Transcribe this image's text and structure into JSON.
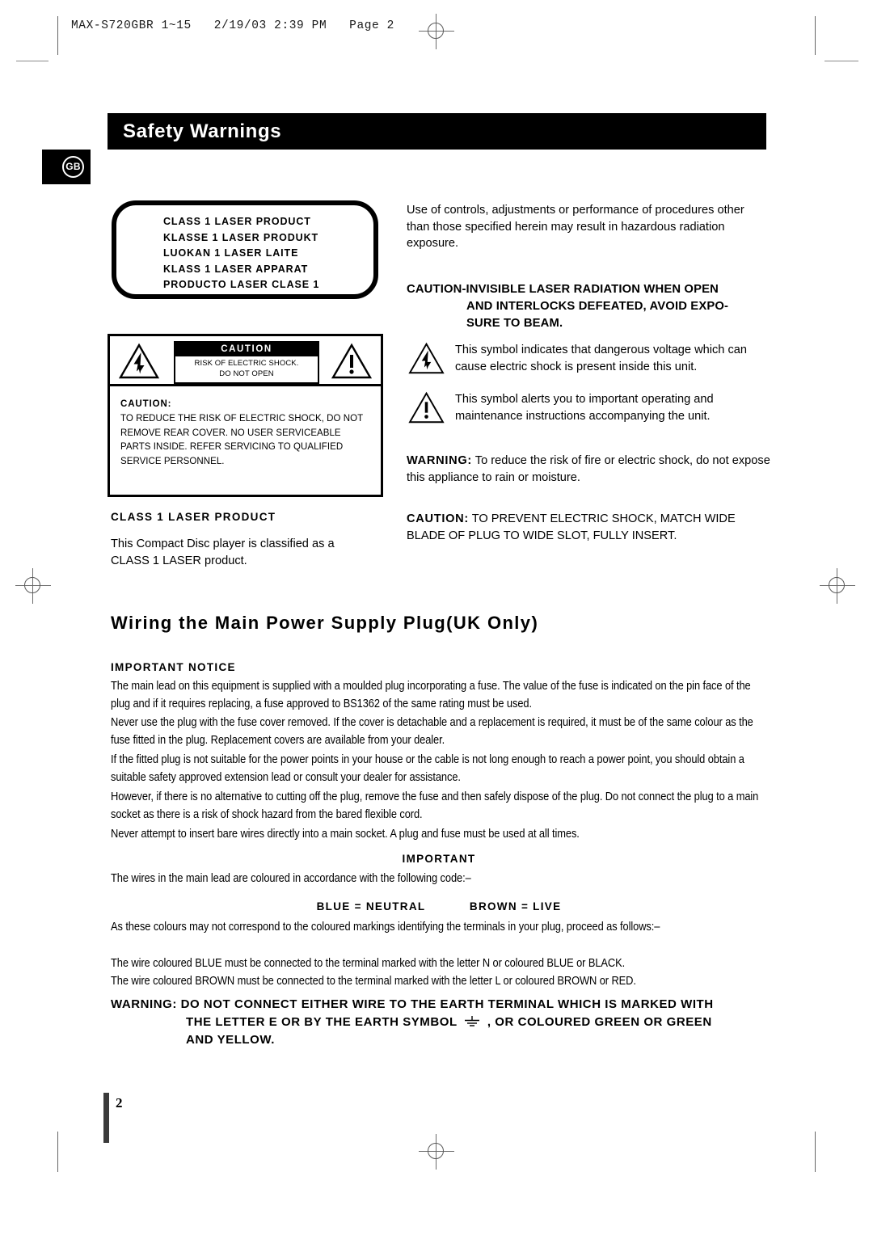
{
  "running_head": "MAX-S720GBR 1~15   2/19/03 2:39 PM   Page 2",
  "header": {
    "title": "Safety Warnings",
    "region_badge": "GB"
  },
  "laser_label_box": {
    "lines": [
      "CLASS 1 LASER PRODUCT",
      "KLASSE 1 LASER PRODUKT",
      "LUOKAN 1 LASER LAITE",
      "KLASS 1 LASER APPARAT",
      "PRODUCTO LASER CLASE 1"
    ]
  },
  "caution_label_box": {
    "banner_title": "CAUTION",
    "banner_line1": "RISK OF ELECTRIC SHOCK.",
    "banner_line2": "DO NOT OPEN",
    "body_label": "CAUTION:",
    "body_text": "TO REDUCE THE RISK OF ELECTRIC SHOCK, DO NOT REMOVE REAR COVER. NO USER SERVICEABLE PARTS INSIDE. REFER SERVICING TO QUALIFIED SERVICE PERSONNEL."
  },
  "right_column": {
    "intro": "Use of controls, adjustments or performance of procedures other than those specified herein may result in hazardous radiation exposure.",
    "laser_caution_line1": "CAUTION-INVISIBLE LASER RADIATION WHEN OPEN",
    "laser_caution_line2": "AND INTERLOCKS DEFEATED, AVOID EXPO-",
    "laser_caution_line3": "SURE TO BEAM.",
    "symbol_voltage_text": "This symbol indicates that dangerous voltage which can cause electric shock is present inside this unit.",
    "symbol_alert_text": "This symbol alerts you to important operating and maintenance instructions accompanying the unit.",
    "warning_lead": "WARNING:",
    "warning_text": "To reduce the risk of fire or electric shock, do not expose this appliance to rain or moisture."
  },
  "class1_section": {
    "heading": "CLASS 1 LASER PRODUCT",
    "text": "This Compact Disc player is classified as a CLASS 1 LASER product."
  },
  "plug_caution": {
    "lead": "CAUTION:",
    "text": "TO PREVENT ELECTRIC SHOCK, MATCH WIDE BLADE OF PLUG TO WIDE SLOT, FULLY INSERT."
  },
  "wiring": {
    "title": "Wiring the Main Power Supply Plug(UK Only)",
    "important_notice_heading": "IMPORTANT NOTICE",
    "paragraphs": [
      "The main lead on this equipment is supplied with a moulded plug incorporating a fuse. The value of the fuse is indicated on the pin face of the plug and if it requires replacing, a fuse approved to BS1362 of the same rating must be used.",
      "Never use the plug with the fuse cover removed. If the cover is detachable and a replacement is required, it must be of the same colour as the fuse fitted in the plug. Replacement covers are available from your dealer.",
      "If the fitted plug is not suitable for the power points in your house or the cable is not long enough to reach a power point, you should obtain a suitable safety approved extension lead or consult your dealer for assistance.",
      "However, if there is no alternative to cutting off the plug, remove the fuse and then safely dispose of the plug. Do not connect the plug to a main socket as there is a risk of shock hazard from the bared flexible cord.",
      "Never attempt to insert bare wires directly into a main socket. A plug and fuse must be used at all times."
    ],
    "important_heading": "IMPORTANT",
    "code_intro": "The wires in the main lead are coloured in accordance with the following code:–",
    "code_blue": "BLUE = NEUTRAL",
    "code_brown": "BROWN = LIVE",
    "proceed_text": "As these colours may not correspond to the coloured markings identifying the terminals in your plug, proceed as follows:–",
    "blue_rule": "The wire coloured BLUE must be connected to the terminal marked with the letter N or coloured BLUE or BLACK.",
    "brown_rule": "The wire coloured BROWN must be connected to the terminal marked with the letter L or coloured BROWN or RED.",
    "earth_warning_lead": "WARNING:",
    "earth_warning_line1": "DO NOT CONNECT EITHER WIRE TO THE EARTH TERMINAL WHICH IS MARKED WITH",
    "earth_warning_line2a": "THE LETTER E OR BY THE EARTH SYMBOL",
    "earth_warning_line2b": ",  OR COLOURED GREEN OR GREEN",
    "earth_warning_line3": "AND YELLOW."
  },
  "footer": {
    "page_number": "2"
  },
  "colors": {
    "ink": "#000000",
    "paper": "#ffffff",
    "mark_grey": "#6a6a6a"
  }
}
